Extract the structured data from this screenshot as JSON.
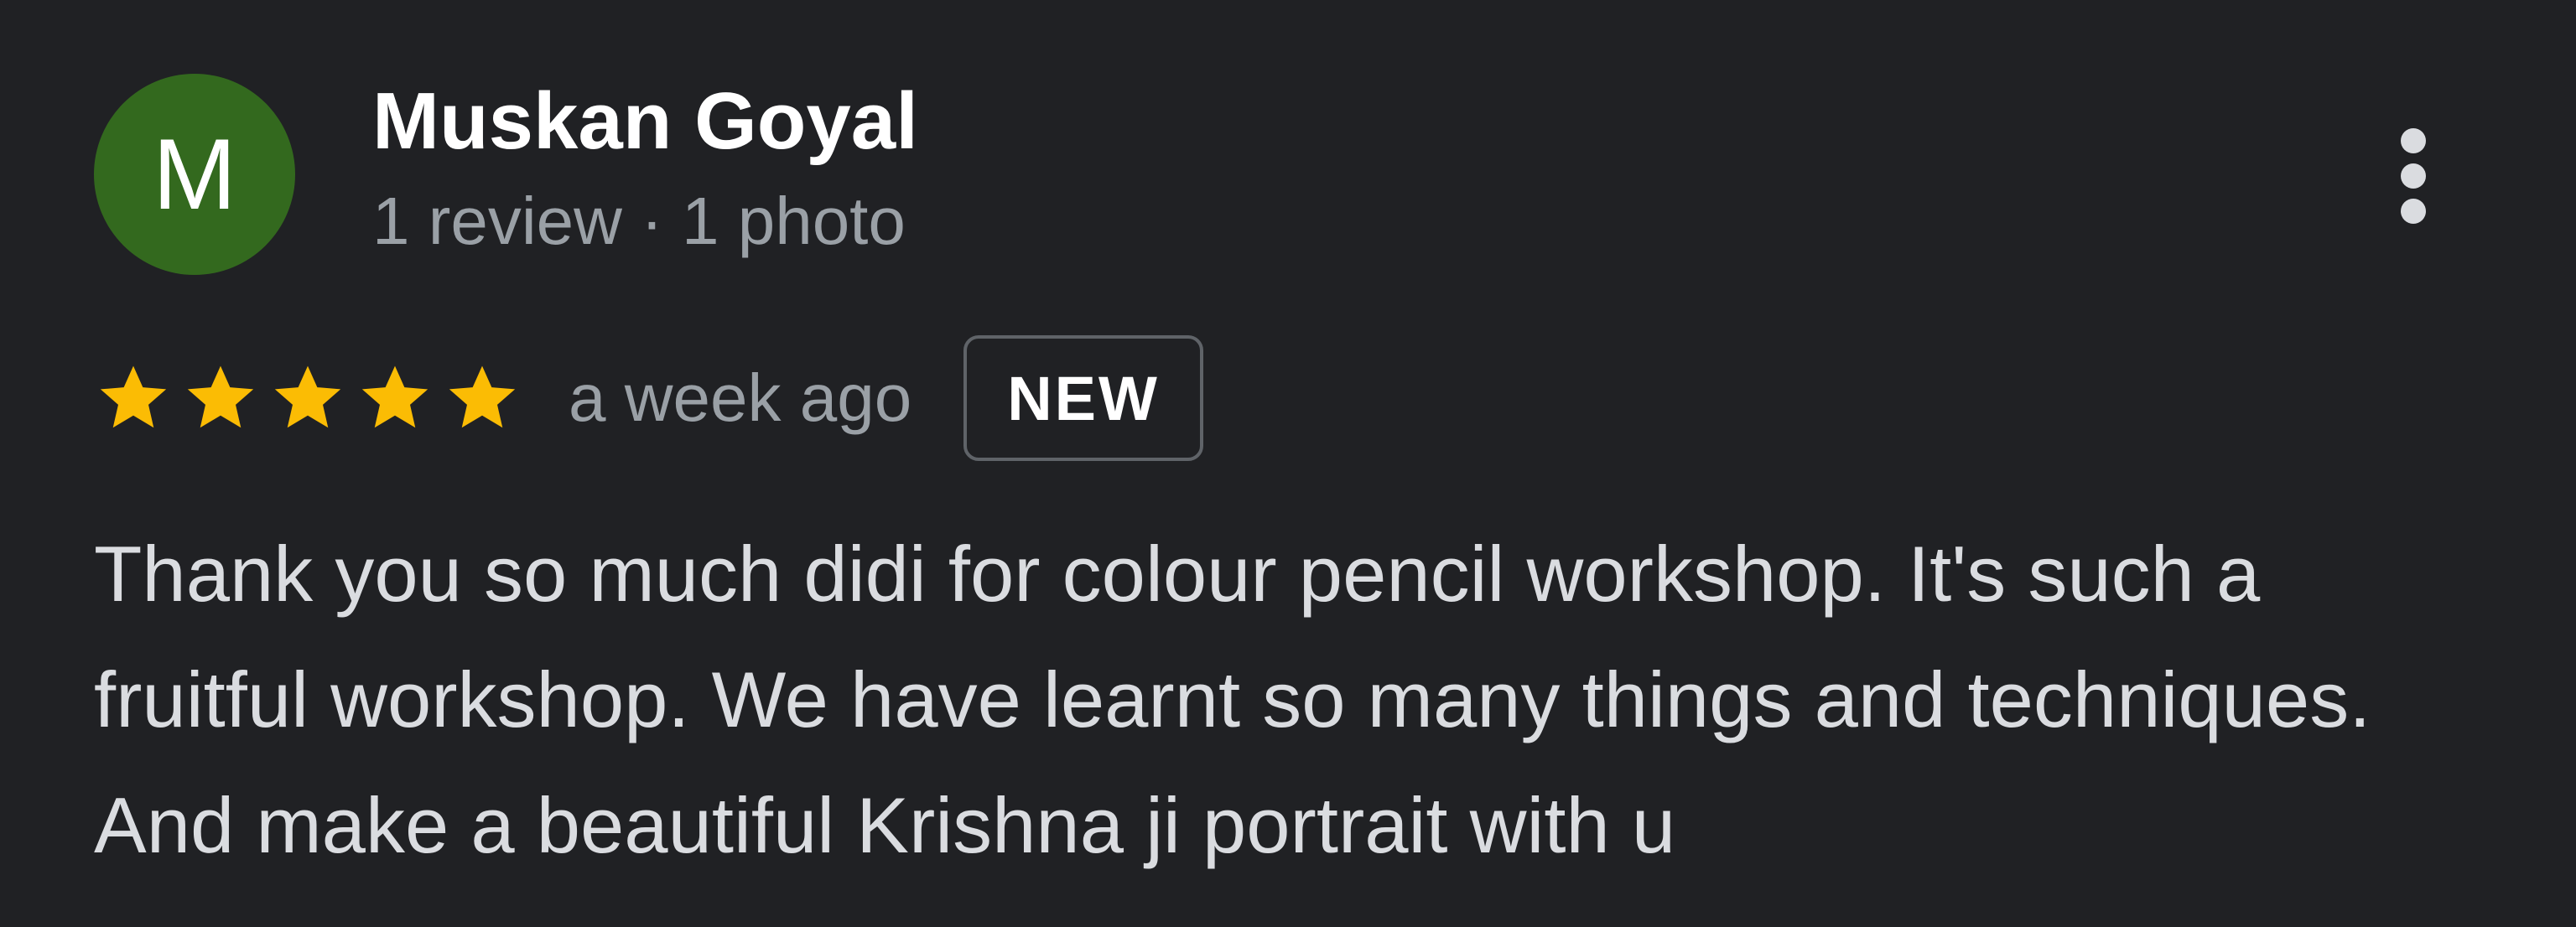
{
  "reviewer": {
    "initial": "M",
    "name": "Muskan Goyal",
    "meta": "1 review · 1 photo",
    "avatar_color": "#33691e"
  },
  "rating": {
    "stars": 5,
    "max_stars": 5,
    "star_color": "#fbbc04",
    "time_ago": "a week ago",
    "badge": "NEW"
  },
  "review": {
    "text": "Thank you so much didi for colour pencil workshop. It's such a fruitful workshop. We have learnt so many things and techniques. And make a beautiful Krishna ji portrait with u"
  },
  "icons": {
    "menu": "more-vert-icon",
    "star": "star-icon"
  }
}
